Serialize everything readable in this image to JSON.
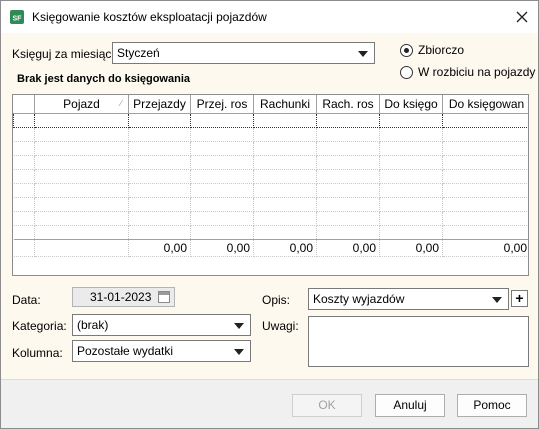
{
  "window": {
    "title": "Księgowanie kosztów eksploatacji pojazdów",
    "icon": "app-logo-icon"
  },
  "form": {
    "month_label": "Księguj za miesiąc:",
    "month_value": "Styczeń",
    "radio_total": "Zbiorczo",
    "radio_split": "W rozbiciu na pojazdy",
    "radio_selected": "total",
    "no_data_message": "Brak jest danych do księgowania"
  },
  "grid": {
    "columns": [
      "",
      "Pojazd",
      "Przejazdy",
      "Przej. ros",
      "Rachunki",
      "Rach. ros",
      "Do księgo",
      "Do księgowan"
    ],
    "empty_rows": 9,
    "totals": [
      "",
      "",
      "0,00",
      "0,00",
      "0,00",
      "0,00",
      "0,00",
      "0,00"
    ]
  },
  "details": {
    "date_label": "Data:",
    "date_value": "31-01-2023",
    "category_label": "Kategoria:",
    "category_value": "(brak)",
    "column_label": "Kolumna:",
    "column_value": "Pozostałe wydatki",
    "description_label": "Opis:",
    "description_value": "Koszty wyjazdów",
    "notes_label": "Uwagi:",
    "notes_value": "",
    "add_label": "+"
  },
  "buttons": {
    "ok": "OK",
    "cancel": "Anuluj",
    "help": "Pomoc"
  }
}
